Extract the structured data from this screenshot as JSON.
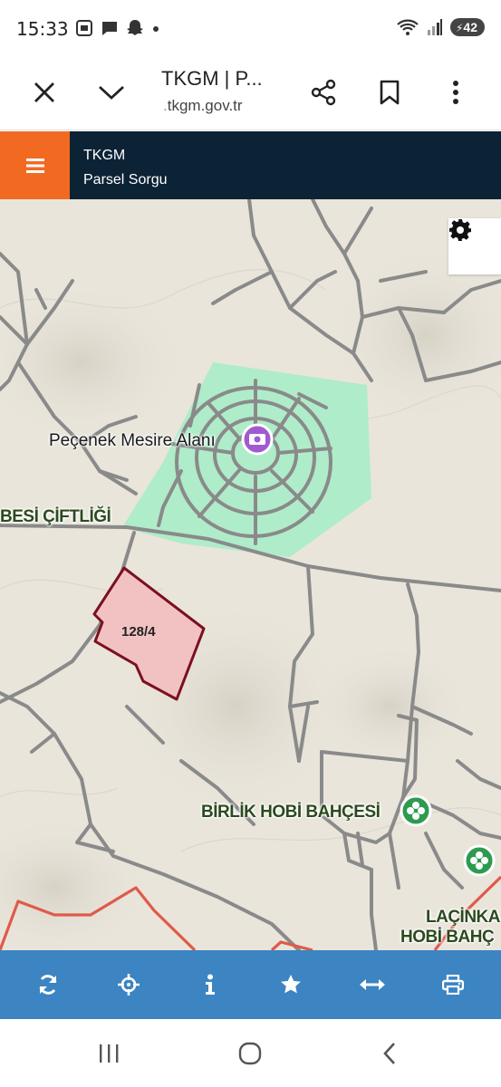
{
  "status_bar": {
    "time": "15:33",
    "battery": "42",
    "notification_icons": [
      "screenshot-icon",
      "chat-icon",
      "snapchat-icon",
      "dot-icon"
    ]
  },
  "browser": {
    "title": "TKGM | P...",
    "url": "tkgm.gov.tr",
    "url_prefix": "."
  },
  "app": {
    "title": "TKGM",
    "subtitle": "Parsel Sorgu",
    "accent_color": "#f26a22",
    "header_color": "#0c2336",
    "toolbar_color": "#3c84c2"
  },
  "map": {
    "labels": {
      "poi_mesire": "Peçenek Mesire Alanı",
      "besi_ciftligi": "BESİ ÇİFTLİĞİ",
      "birlik_hobi": "BİRLİK HOBİ BAHÇESİ",
      "lacinkaya": "LAÇİNKA",
      "hobi_bahce": "HOBİ BAHÇ"
    },
    "parcel": "128/4",
    "parcel_fill": "#f2c2c2",
    "parcel_stroke": "#7a1020",
    "park_color": "#a8ecc8",
    "road_color": "#8a8a8a"
  },
  "bottom_toolbar": {
    "buttons": [
      "refresh-icon",
      "locate-icon",
      "info-icon",
      "favorite-icon",
      "measure-icon",
      "print-icon"
    ]
  }
}
